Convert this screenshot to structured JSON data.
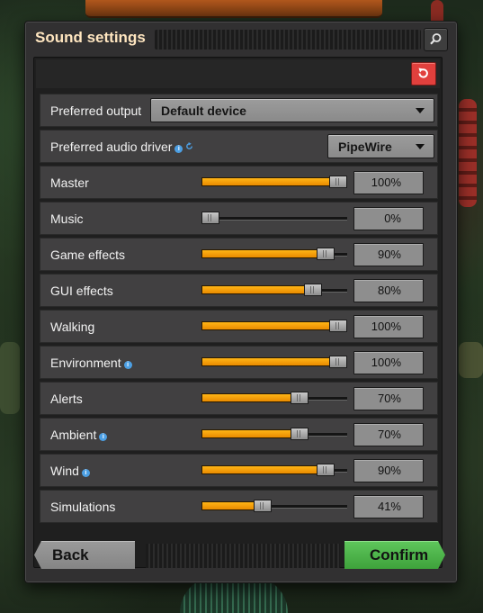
{
  "window": {
    "title": "Sound settings",
    "search_icon": "search-icon",
    "reset_icon": "reset-icon",
    "colors": {
      "reset": "#e1403d",
      "confirm": "#4bb248",
      "slider_fill": "#f5a10a",
      "title_text": "#ffe6c0"
    }
  },
  "output": {
    "label": "Preferred output",
    "value": "Default device"
  },
  "driver": {
    "label": "Preferred audio driver",
    "value": "PipeWire",
    "icons": [
      "info-icon",
      "refresh-icon"
    ]
  },
  "sliders": [
    {
      "label": "Master",
      "value": 1.0,
      "display": "100%",
      "info": false
    },
    {
      "label": "Music",
      "value": 0.0,
      "display": "0%",
      "info": false
    },
    {
      "label": "Game effects",
      "value": 0.9,
      "display": "90%",
      "info": false
    },
    {
      "label": "GUI effects",
      "value": 0.8,
      "display": "80%",
      "info": false
    },
    {
      "label": "Walking",
      "value": 1.0,
      "display": "100%",
      "info": false
    },
    {
      "label": "Environment",
      "value": 1.0,
      "display": "100%",
      "info": true
    },
    {
      "label": "Alerts",
      "value": 0.7,
      "display": "70%",
      "info": false
    },
    {
      "label": "Ambient",
      "value": 0.7,
      "display": "70%",
      "info": true
    },
    {
      "label": "Wind",
      "value": 0.9,
      "display": "90%",
      "info": true
    },
    {
      "label": "Simulations",
      "value": 0.41,
      "display": "41%",
      "info": false
    }
  ],
  "footer": {
    "back_label": "Back",
    "confirm_label": "Confirm"
  }
}
